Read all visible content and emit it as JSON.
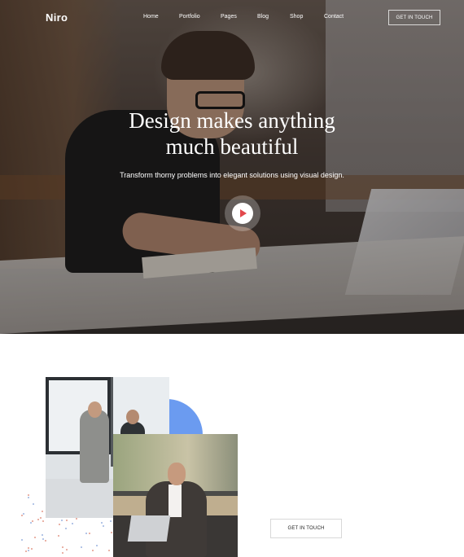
{
  "nav": {
    "logo": "Niro",
    "links": [
      "Home",
      "Portfolio",
      "Pages",
      "Blog",
      "Shop",
      "Contact"
    ],
    "cta": "GET IN TOUCH"
  },
  "hero": {
    "title_line1": "Design makes anything",
    "title_line2": "much beautiful",
    "subtitle": "Transform thorny problems into elegant solutions using visual design.",
    "play_icon": "play-icon"
  },
  "about": {
    "cta": "GET IN TOUCH",
    "accent_color": "#6b9bf0"
  },
  "colors": {
    "play_red": "#e2484c",
    "dots_red": "#e49a8a",
    "dots_blue": "#9bb3e0"
  }
}
